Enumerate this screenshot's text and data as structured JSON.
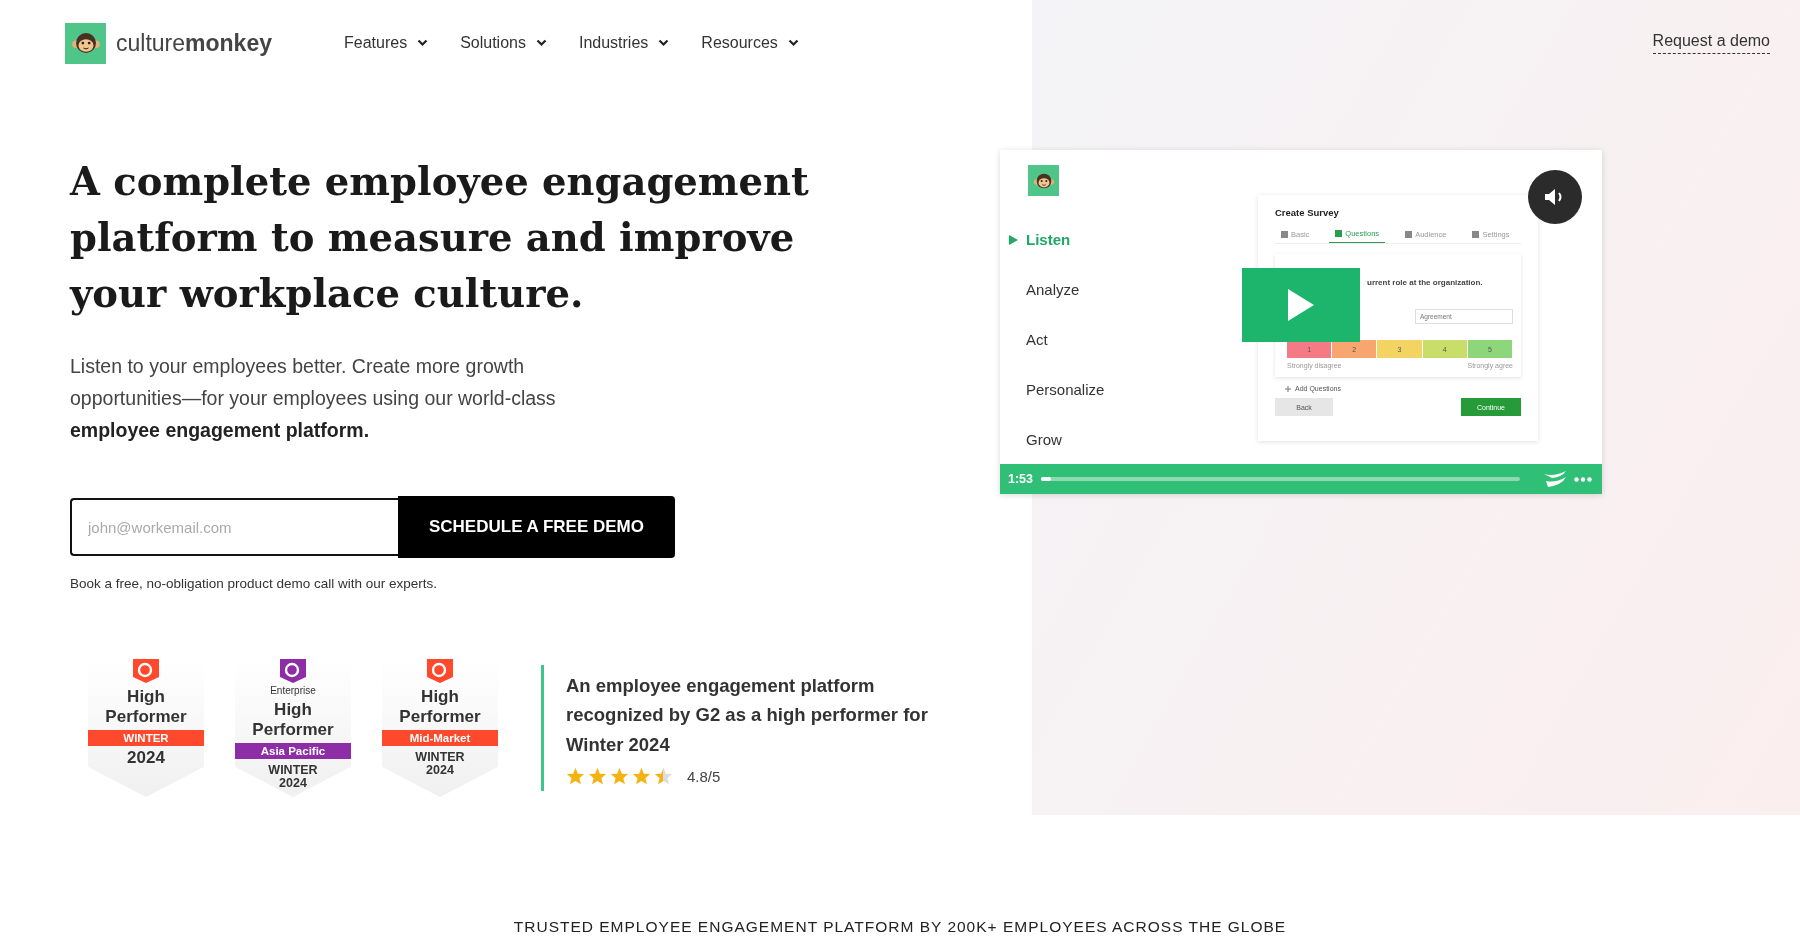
{
  "header": {
    "brand": {
      "light": "culture",
      "bold": "monkey"
    },
    "nav": [
      {
        "label": "Features"
      },
      {
        "label": "Solutions"
      },
      {
        "label": "Industries"
      },
      {
        "label": "Resources"
      }
    ],
    "cta": "Request a demo"
  },
  "hero": {
    "title": "A complete employee engagement platform to measure and improve your workplace culture.",
    "subtitle": "Listen to your employees better. Create more growth opportunities—for your employees using our world-class **employee engagement platform.**",
    "email_field": {
      "placeholder": "john@workemail.com"
    },
    "submit": "SCHEDULE A FREE DEMO",
    "note": "Book a free, no-obligation product demo call with our experts."
  },
  "badges": [
    {
      "title": "High Performer",
      "ribbon": "WINTER",
      "footer": "2024",
      "color": "#ff492c"
    },
    {
      "label": "Enterprise",
      "title": "High Performer",
      "ribbon": "Asia Pacific",
      "footer": "WINTER 2024",
      "color": "#8d2ea6"
    },
    {
      "title": "High Performer",
      "ribbon": "Mid-Market",
      "footer": "WINTER 2024",
      "color": "#ff492c"
    }
  ],
  "recognition": {
    "text": "An employee engagement platform recognized by G2 as a high performer for Winter 2024",
    "stars": 4.5,
    "rating": "4.8/5"
  },
  "video": {
    "menu": [
      {
        "label": "Listen",
        "selected": true
      },
      {
        "label": "Analyze",
        "selected": false
      },
      {
        "label": "Act",
        "selected": false
      },
      {
        "label": "Personalize",
        "selected": false
      },
      {
        "label": "Grow",
        "selected": false
      }
    ],
    "survey": {
      "title": "Create Survey",
      "tabs": [
        {
          "label": "Basic",
          "selected": false
        },
        {
          "label": "Questions",
          "selected": true
        },
        {
          "label": "Audience",
          "selected": false
        },
        {
          "label": "Settings",
          "selected": false
        }
      ],
      "question": "urrent role at the organization.",
      "dropdown": "Agreement",
      "scale": [
        "1",
        "2",
        "3",
        "4",
        "5"
      ],
      "scale_low": "Strongly disagree",
      "scale_high": "Strongly agree",
      "add": "Add Questions",
      "back": "Back",
      "continue": "Continue"
    },
    "time": "1:53",
    "level": 0.02
  },
  "trusted": "TRUSTED EMPLOYEE ENGAGEMENT PLATFORM BY 200K+ EMPLOYEES ACROSS THE GLOBE"
}
